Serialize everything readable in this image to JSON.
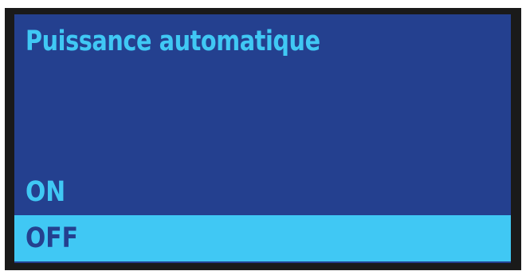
{
  "screen": {
    "title": "Puissance automatique",
    "colors": {
      "background": "#24408f",
      "accent": "#40c8f4",
      "bezel": "#1a1a1a"
    }
  },
  "menu": {
    "options": [
      {
        "label": "ON",
        "selected": false
      },
      {
        "label": "OFF",
        "selected": true
      }
    ]
  }
}
